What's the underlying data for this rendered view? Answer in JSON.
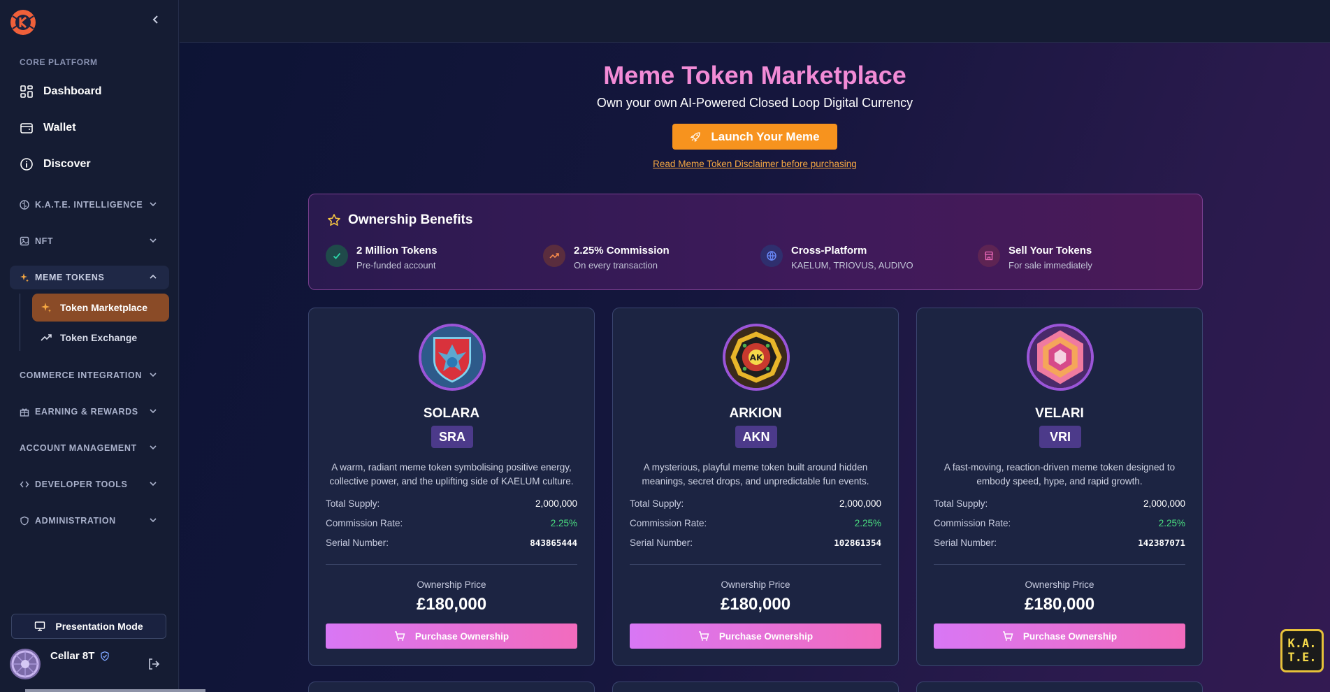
{
  "sidebar": {
    "section_label": "CORE PLATFORM",
    "items": [
      {
        "label": "Dashboard",
        "icon": "dashboard-icon"
      },
      {
        "label": "Wallet",
        "icon": "wallet-icon"
      },
      {
        "label": "Discover",
        "icon": "info-icon"
      }
    ],
    "groups": {
      "kate": "K.A.T.E. INTELLIGENCE",
      "nft": "NFT",
      "meme": "MEME TOKENS",
      "commerce": "COMMERCE INTEGRATION",
      "earning": "EARNING & REWARDS",
      "account": "ACCOUNT MANAGEMENT",
      "developer": "DEVELOPER TOOLS",
      "admin": "ADMINISTRATION"
    },
    "sub_items": [
      {
        "label": "Token Marketplace",
        "active": true
      },
      {
        "label": "Token Exchange",
        "active": false
      }
    ],
    "presentation_label": "Presentation Mode",
    "user": {
      "name": "Cellar 8T"
    }
  },
  "hero": {
    "title": "Meme Token Marketplace",
    "subtitle": "Own your own AI-Powered Closed Loop Digital Currency",
    "launch_label": "Launch Your Meme",
    "disclaimer": "Read Meme Token Disclaimer before purchasing"
  },
  "benefits": {
    "title": "Ownership Benefits",
    "items": [
      {
        "title": "2 Million Tokens",
        "sub": "Pre-funded account",
        "icon": "check-icon",
        "color": "#2dd4a8"
      },
      {
        "title": "2.25% Commission",
        "sub": "On every transaction",
        "icon": "trending-up-icon",
        "color": "#f5894a"
      },
      {
        "title": "Cross-Platform",
        "sub": "KAELUM, TRIOVUS, AUDIVO",
        "icon": "globe-icon",
        "color": "#6b8cff"
      },
      {
        "title": "Sell Your Tokens",
        "sub": "For sale immediately",
        "icon": "store-icon",
        "color": "#f26bbd"
      }
    ]
  },
  "labels": {
    "total_supply": "Total Supply:",
    "commission_rate": "Commission Rate:",
    "serial_number": "Serial Number:",
    "ownership_price": "Ownership Price",
    "purchase": "Purchase Ownership"
  },
  "tokens": [
    {
      "name": "SOLARA",
      "ticker": "SRA",
      "description": "A warm, radiant meme token symbolising positive energy, collective power, and the uplifting side of KAELUM culture.",
      "supply": "2,000,000",
      "commission": "2.25%",
      "serial": "843865444",
      "price": "£180,000"
    },
    {
      "name": "ARKION",
      "ticker": "AKN",
      "description": "A mysterious, playful meme token built around hidden meanings, secret drops, and unpredictable fun events.",
      "supply": "2,000,000",
      "commission": "2.25%",
      "serial": "102861354",
      "price": "£180,000"
    },
    {
      "name": "VELARI",
      "ticker": "VRI",
      "description": "A fast-moving, reaction-driven meme token designed to embody speed, hype, and rapid growth.",
      "supply": "2,000,000",
      "commission": "2.25%",
      "serial": "142387071",
      "price": "£180,000"
    }
  ],
  "assistant_badge": {
    "line1": "K.A.",
    "line2": "T.E."
  },
  "colors": {
    "accent_orange": "#f7931e",
    "accent_pink": "#f28bd6",
    "active_sidebar": "#8a4b27",
    "commission_green": "#4ade80"
  }
}
